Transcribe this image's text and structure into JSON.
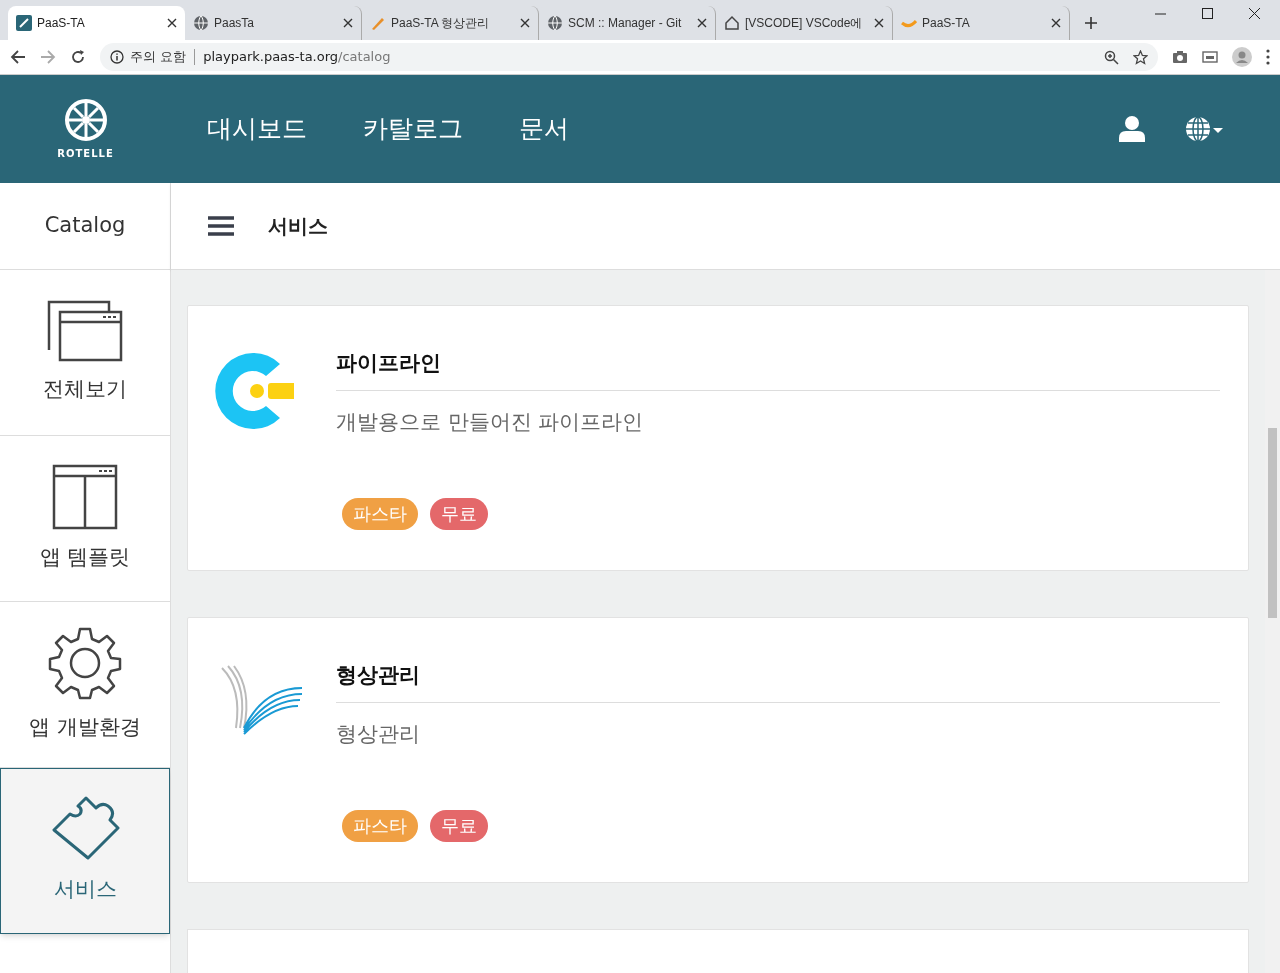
{
  "browser": {
    "tabs": [
      {
        "title": "PaaS-TA",
        "selected": true,
        "kind": "paas"
      },
      {
        "title": "PaasTa",
        "selected": false,
        "kind": "globe"
      },
      {
        "title": "PaaS-TA 형상관리",
        "selected": false,
        "kind": "pen"
      },
      {
        "title": "SCM :: Manager - Git",
        "selected": false,
        "kind": "globe"
      },
      {
        "title": "[VSCODE] VSCode에",
        "selected": false,
        "kind": "house"
      },
      {
        "title": "PaaS-TA",
        "selected": false,
        "kind": "wave"
      }
    ],
    "security_label": "주의 요함",
    "url_host": "playpark.paas-ta.org",
    "url_path": "/catalog"
  },
  "header": {
    "logo_text": "ROTELLE",
    "nav": [
      "대시보드",
      "카탈로그",
      "문서"
    ]
  },
  "sidebar": {
    "title": "Catalog",
    "items": [
      {
        "label": "전체보기",
        "kind": "windows",
        "selected": false
      },
      {
        "label": "앱 템플릿",
        "kind": "template",
        "selected": false
      },
      {
        "label": "앱 개발환경",
        "kind": "gear",
        "selected": false
      },
      {
        "label": "서비스",
        "kind": "puzzle",
        "selected": true
      }
    ]
  },
  "page_title": "서비스",
  "cards": [
    {
      "title": "파이프라인",
      "description": "개발용으로 만들어진 파이프라인",
      "kind": "pipeline",
      "tags": [
        {
          "label": "파스타",
          "color": "#f0a044"
        },
        {
          "label": "무료",
          "color": "#e4686a"
        }
      ]
    },
    {
      "title": "형상관리",
      "description": "형상관리",
      "kind": "scm",
      "tags": [
        {
          "label": "파스타",
          "color": "#f0a044"
        },
        {
          "label": "무료",
          "color": "#e4686a"
        }
      ]
    }
  ]
}
